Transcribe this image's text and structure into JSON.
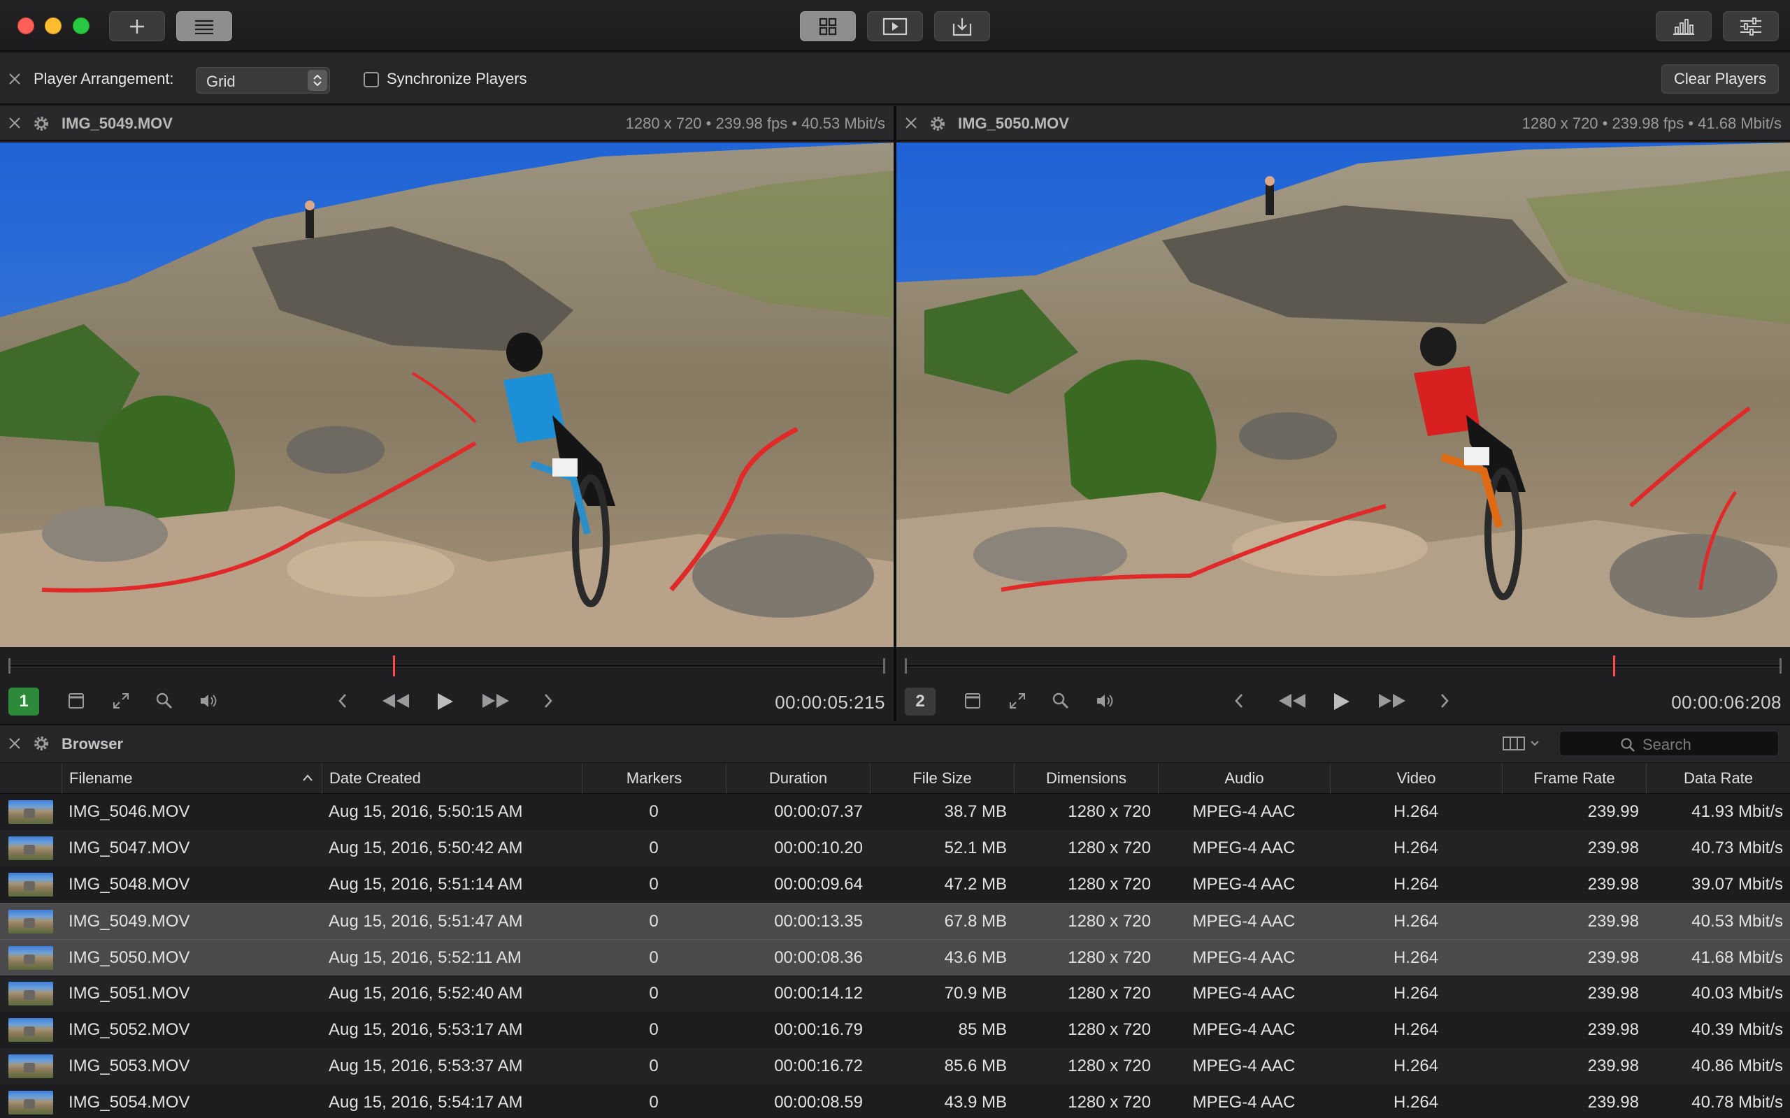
{
  "toolbar": {
    "add_icon": "plus-icon",
    "list_icon": "list-icon",
    "grid_icon": "grid-icon",
    "player_icon": "play-window-icon",
    "import_icon": "import-icon",
    "stats_icon": "bar-chart-icon",
    "settings_icon": "sliders-icon"
  },
  "arrangement": {
    "label": "Player Arrangement:",
    "value": "Grid",
    "sync_label": "Synchronize Players",
    "sync_checked": false,
    "clear_label": "Clear Players"
  },
  "players": [
    {
      "number": "1",
      "filename": "IMG_5049.MOV",
      "meta": "1280 x 720 • 239.98 fps • 40.53 Mbit/s",
      "timecode": "00:00:05:215",
      "playhead_fraction": 0.44,
      "active": true
    },
    {
      "number": "2",
      "filename": "IMG_5050.MOV",
      "meta": "1280 x 720 • 239.98 fps • 41.68 Mbit/s",
      "timecode": "00:00:06:208",
      "playhead_fraction": 0.81,
      "active": false
    }
  ],
  "browser": {
    "title": "Browser",
    "search_placeholder": "Search",
    "columns": [
      "Filename",
      "Date Created",
      "Markers",
      "Duration",
      "File Size",
      "Dimensions",
      "Audio",
      "Video",
      "Frame Rate",
      "Data Rate"
    ],
    "sort_column": "Filename",
    "rows": [
      {
        "filename": "IMG_5046.MOV",
        "date": "Aug 15, 2016, 5:50:15 AM",
        "markers": "0",
        "duration": "00:00:07.37",
        "size": "38.7 MB",
        "dimensions": "1280 x 720",
        "audio": "MPEG-4 AAC",
        "video": "H.264",
        "frame_rate": "239.99",
        "data_rate": "41.93 Mbit/s",
        "selected": false
      },
      {
        "filename": "IMG_5047.MOV",
        "date": "Aug 15, 2016, 5:50:42 AM",
        "markers": "0",
        "duration": "00:00:10.20",
        "size": "52.1 MB",
        "dimensions": "1280 x 720",
        "audio": "MPEG-4 AAC",
        "video": "H.264",
        "frame_rate": "239.98",
        "data_rate": "40.73 Mbit/s",
        "selected": false
      },
      {
        "filename": "IMG_5048.MOV",
        "date": "Aug 15, 2016, 5:51:14 AM",
        "markers": "0",
        "duration": "00:00:09.64",
        "size": "47.2 MB",
        "dimensions": "1280 x 720",
        "audio": "MPEG-4 AAC",
        "video": "H.264",
        "frame_rate": "239.98",
        "data_rate": "39.07 Mbit/s",
        "selected": false
      },
      {
        "filename": "IMG_5049.MOV",
        "date": "Aug 15, 2016, 5:51:47 AM",
        "markers": "0",
        "duration": "00:00:13.35",
        "size": "67.8 MB",
        "dimensions": "1280 x 720",
        "audio": "MPEG-4 AAC",
        "video": "H.264",
        "frame_rate": "239.98",
        "data_rate": "40.53 Mbit/s",
        "selected": true
      },
      {
        "filename": "IMG_5050.MOV",
        "date": "Aug 15, 2016, 5:52:11 AM",
        "markers": "0",
        "duration": "00:00:08.36",
        "size": "43.6 MB",
        "dimensions": "1280 x 720",
        "audio": "MPEG-4 AAC",
        "video": "H.264",
        "frame_rate": "239.98",
        "data_rate": "41.68 Mbit/s",
        "selected": true
      },
      {
        "filename": "IMG_5051.MOV",
        "date": "Aug 15, 2016, 5:52:40 AM",
        "markers": "0",
        "duration": "00:00:14.12",
        "size": "70.9 MB",
        "dimensions": "1280 x 720",
        "audio": "MPEG-4 AAC",
        "video": "H.264",
        "frame_rate": "239.98",
        "data_rate": "40.03 Mbit/s",
        "selected": false
      },
      {
        "filename": "IMG_5052.MOV",
        "date": "Aug 15, 2016, 5:53:17 AM",
        "markers": "0",
        "duration": "00:00:16.79",
        "size": "85 MB",
        "dimensions": "1280 x 720",
        "audio": "MPEG-4 AAC",
        "video": "H.264",
        "frame_rate": "239.98",
        "data_rate": "40.39 Mbit/s",
        "selected": false
      },
      {
        "filename": "IMG_5053.MOV",
        "date": "Aug 15, 2016, 5:53:37 AM",
        "markers": "0",
        "duration": "00:00:16.72",
        "size": "85.6 MB",
        "dimensions": "1280 x 720",
        "audio": "MPEG-4 AAC",
        "video": "H.264",
        "frame_rate": "239.98",
        "data_rate": "40.86 Mbit/s",
        "selected": false
      },
      {
        "filename": "IMG_5054.MOV",
        "date": "Aug 15, 2016, 5:54:17 AM",
        "markers": "0",
        "duration": "00:00:08.59",
        "size": "43.9 MB",
        "dimensions": "1280 x 720",
        "audio": "MPEG-4 AAC",
        "video": "H.264",
        "frame_rate": "239.98",
        "data_rate": "40.78 Mbit/s",
        "selected": false
      }
    ]
  }
}
